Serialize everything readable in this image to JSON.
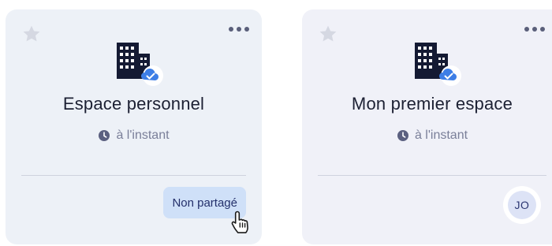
{
  "cards": [
    {
      "title": "Espace personnel",
      "time": "à l'instant",
      "action_label": "Non partagé",
      "star_icon": "star-icon",
      "menu_icon": "more-icon",
      "main_icon": "building-cloud-icon"
    },
    {
      "title": "Mon premier espace",
      "time": "à l'instant",
      "avatar_initials": "JO",
      "star_icon": "star-icon",
      "menu_icon": "more-icon",
      "main_icon": "building-cloud-icon"
    }
  ],
  "colors": {
    "card_bg": "#edf1f7",
    "title": "#1c2033",
    "muted": "#7a7f99",
    "button_bg": "#cfe0f8",
    "cloud_badge": "#3d7ee6"
  }
}
